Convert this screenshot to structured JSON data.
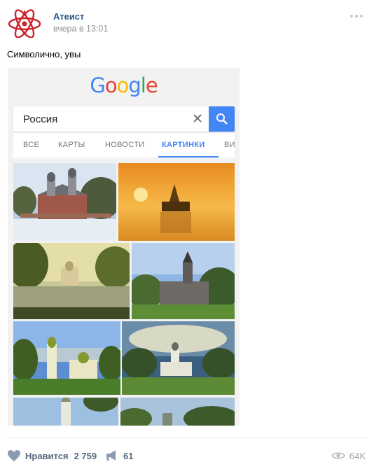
{
  "post": {
    "author": "Атеист",
    "time": "вчера в 13:01",
    "text": "Символично, увы"
  },
  "google": {
    "logo_letters": [
      "G",
      "o",
      "o",
      "g",
      "l",
      "e"
    ],
    "logo_colors": [
      "#4285f4",
      "#ea4335",
      "#fbbc05",
      "#4285f4",
      "#34a853",
      "#ea4335"
    ],
    "query": "Россия",
    "tabs": [
      "ВСЕ",
      "КАРТЫ",
      "НОВОСТИ",
      "КАРТИНКИ",
      "ВИ"
    ],
    "active_tab": "КАРТИНКИ",
    "accent": "#4285f4"
  },
  "footer": {
    "like_label": "Нравится",
    "like_count": "2 759",
    "share_count": "61",
    "views_count": "64K"
  },
  "icons": [
    "avatar-atom-logo",
    "more-icon",
    "clear-icon",
    "search-icon",
    "heart-icon",
    "megaphone-icon",
    "eye-icon"
  ]
}
